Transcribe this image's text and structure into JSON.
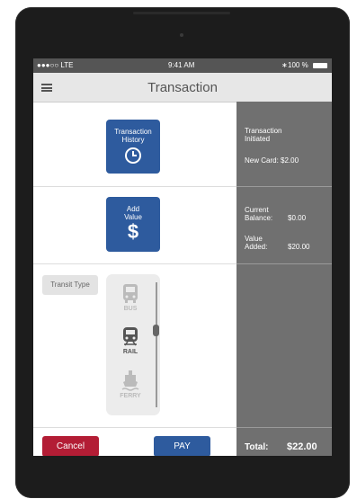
{
  "status": {
    "carrier": "●●●○○ LTE",
    "time": "9:41 AM",
    "battery": "100 %"
  },
  "header": {
    "title": "Transaction"
  },
  "tiles": {
    "history": {
      "line1": "Transaction",
      "line2": "History"
    },
    "add_value": {
      "line1": "Add",
      "line2": "Value",
      "symbol": "$"
    }
  },
  "panel": {
    "initiated_line1": "Transaction",
    "initiated_line2": "Initiated",
    "new_card": "New Card: $2.00",
    "current_label1": "Current",
    "current_label2": "Balance:",
    "current_value": "$0.00",
    "value_label1": "Value",
    "value_label2": "Added:",
    "value_value": "$20.00"
  },
  "transit": {
    "label": "Transit Type",
    "options": [
      "BUS",
      "RAIL",
      "FERRY"
    ],
    "selected": "RAIL"
  },
  "footer": {
    "cancel": "Cancel",
    "pay": "PAY",
    "total_label": "Total:",
    "total_value": "$22.00"
  },
  "colors": {
    "accent_blue": "#2e5b9e",
    "cancel_red": "#b31d35",
    "panel_gray": "#707070"
  }
}
